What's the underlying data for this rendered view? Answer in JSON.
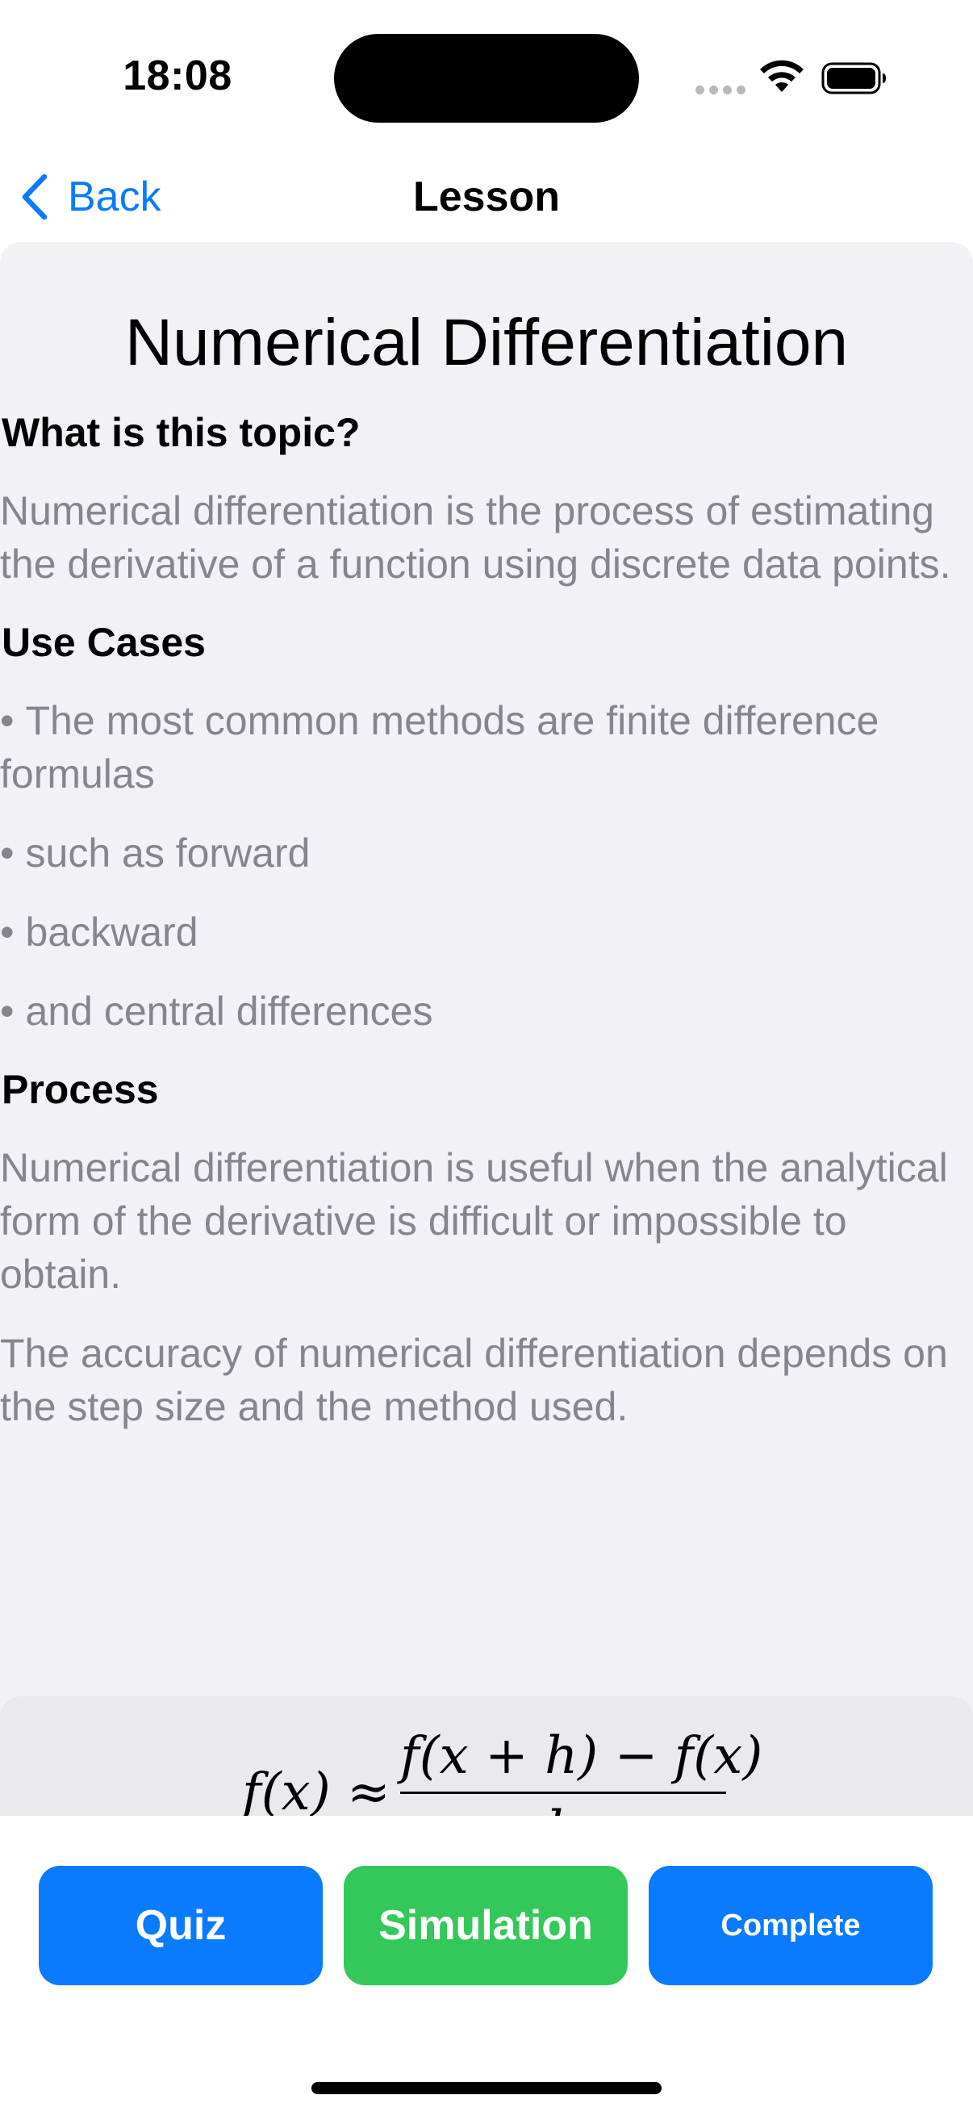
{
  "status_bar": {
    "time": "18:08"
  },
  "nav": {
    "back_label": "Back",
    "title": "Lesson"
  },
  "lesson": {
    "title": "Numerical Differentiation",
    "sections": {
      "what": {
        "heading": "What is this topic?",
        "body": "Numerical differentiation is the process of estimating the derivative of a function using discrete data points."
      },
      "use_cases": {
        "heading": "Use Cases",
        "items": [
          "The most common methods are finite difference formulas",
          "such as forward",
          "backward",
          "and central differences"
        ]
      },
      "process": {
        "heading": "Process",
        "paragraphs": [
          "Numerical differentiation is useful when the analytical form of the derivative is difficult or impossible to obtain.",
          "The accuracy of numerical differentiation depends on the step size and the method used."
        ]
      }
    },
    "formula": {
      "lhs": "f(x) ≈",
      "numerator": "f(x + h) − f(x)",
      "denominator": "h"
    }
  },
  "actions": {
    "quiz": "Quiz",
    "simulation": "Simulation",
    "complete": "Complete"
  },
  "colors": {
    "accent_blue": "#0a7aff",
    "simulation_green": "#34c85a",
    "content_background": "#f1f1f6",
    "secondary_text": "#85858b"
  }
}
